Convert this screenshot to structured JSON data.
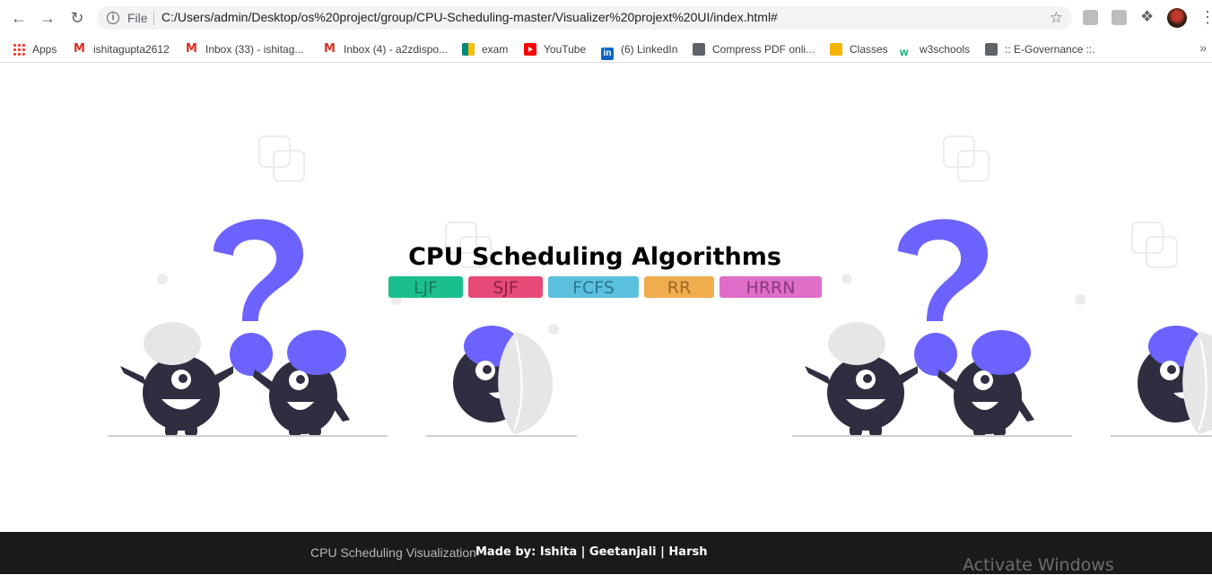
{
  "browser": {
    "scheme_label": "File",
    "url": "C:/Users/admin/Desktop/os%20project/group/CPU-Scheduling-master/Visualizer%20projext%20UI/index.html#"
  },
  "bookmarks": [
    {
      "label": "Apps",
      "icon": "apps-grid-icon"
    },
    {
      "label": "ishitagupta2612",
      "icon": "gmail-icon"
    },
    {
      "label": "Inbox (33) - ishitag...",
      "icon": "gmail-icon"
    },
    {
      "label": "Inbox (4) - a2zdispo...",
      "icon": "gmail-icon"
    },
    {
      "label": "exam",
      "icon": "meet-icon"
    },
    {
      "label": "YouTube",
      "icon": "youtube-icon"
    },
    {
      "label": "(6) LinkedIn",
      "icon": "linkedin-icon"
    },
    {
      "label": "Compress PDF onli...",
      "icon": "globe-icon"
    },
    {
      "label": "Classes",
      "icon": "classroom-icon"
    },
    {
      "label": "w3schools",
      "icon": "w3schools-icon"
    },
    {
      "label": ":: E-Governance ::.",
      "icon": "globe-icon"
    }
  ],
  "main": {
    "title": "CPU Scheduling Algorithms",
    "algorithms": [
      {
        "label": "LJF",
        "color": "#1bbf8e"
      },
      {
        "label": "SJF",
        "color": "#e64b78"
      },
      {
        "label": "FCFS",
        "color": "#5bc0de"
      },
      {
        "label": "RR",
        "color": "#f0ad4e"
      },
      {
        "label": "HRRN",
        "color": "#de6ec8"
      }
    ]
  },
  "footer": {
    "title": "CPU Scheduling Visualization",
    "credit": "Made by: Ishita | Geetanjali | Harsh"
  },
  "os_watermark": "Activate Windows",
  "colors": {
    "accent_purple": "#6c63ff",
    "character_dark": "#2f2e41",
    "footer_bg": "#1a1a1a"
  }
}
